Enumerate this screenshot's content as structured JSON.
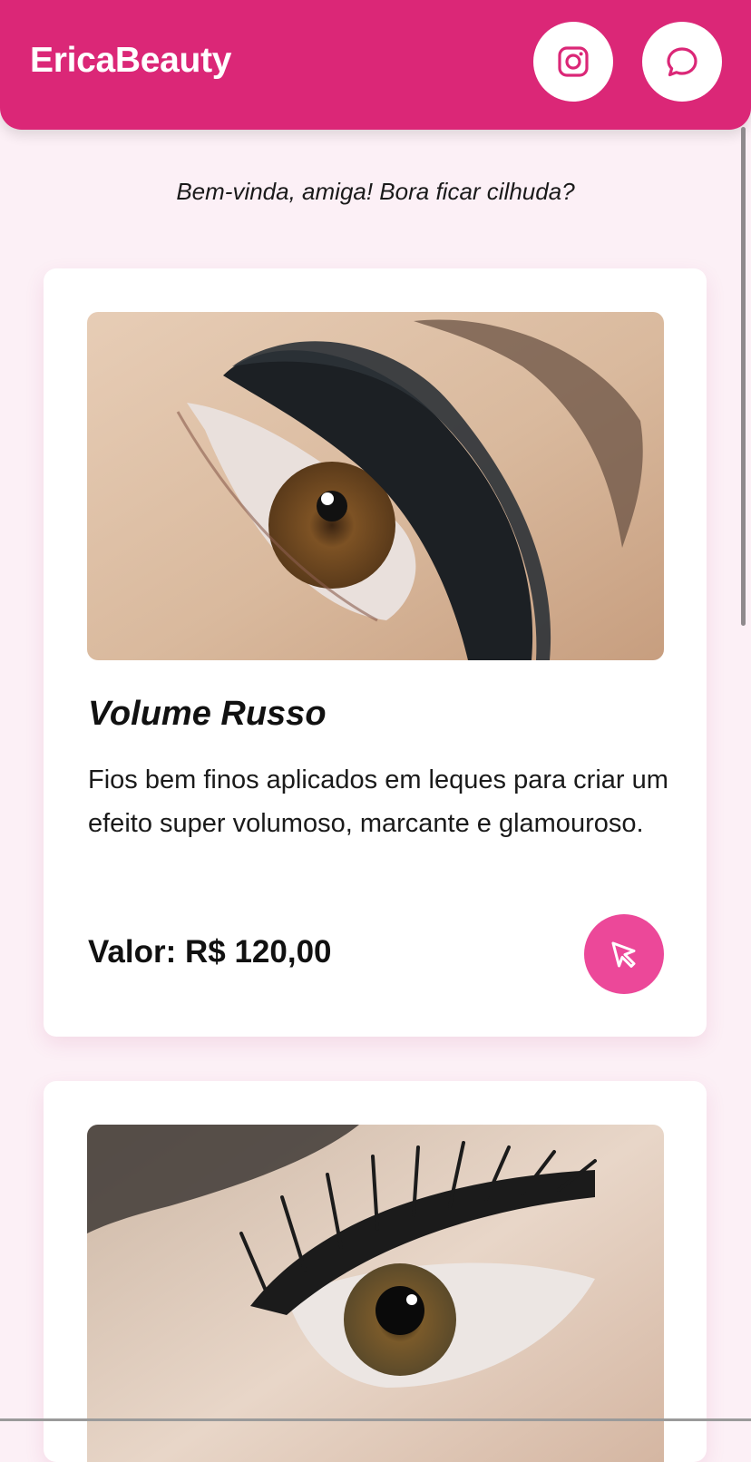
{
  "header": {
    "brand": "EricaBeauty",
    "instagram_icon": "instagram-icon",
    "chat_icon": "message-circle-icon"
  },
  "welcome": "Bem-vinda, amiga! Bora ficar cilhuda?",
  "services": [
    {
      "title": "Volume Russo",
      "description": "Fios bem finos aplicados em leques para criar um efeito super volumoso, marcante e glamouroso.",
      "price": "Valor: R$ 120,00",
      "select_icon": "cursor-pointer-icon"
    }
  ],
  "colors": {
    "header": "#db2777",
    "accent": "#ec4899",
    "background": "#fcf0f6"
  }
}
